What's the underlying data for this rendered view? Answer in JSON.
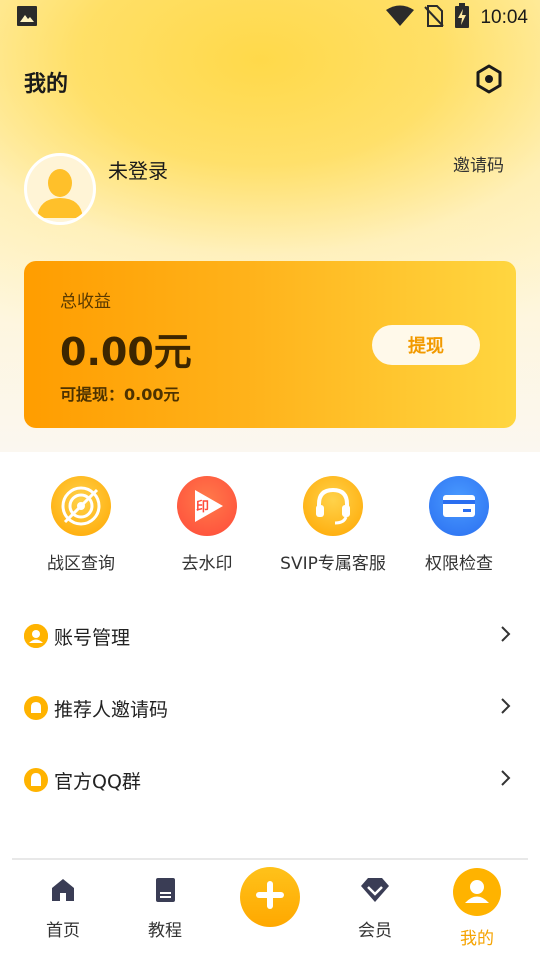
{
  "status_bar": {
    "time": "10:04"
  },
  "header": {
    "title": "我的"
  },
  "profile": {
    "username": "未登录",
    "invite_code_label": "邀请码"
  },
  "earnings": {
    "label": "总收益",
    "amount": "0.00元",
    "withdrawable": "可提现：0.00元",
    "withdraw_button": "提现"
  },
  "tools": [
    {
      "label": "战区查询",
      "icon": "target-icon",
      "color": "#ffb300"
    },
    {
      "label": "去水印",
      "icon": "play-stamp-icon",
      "color": "#ff5a3c"
    },
    {
      "label": "SVIP专属客服",
      "icon": "headset-icon",
      "color": "#ffb300"
    },
    {
      "label": "权限检查",
      "icon": "card-icon",
      "color": "#2f7cf6"
    }
  ],
  "menu": [
    {
      "label": "账号管理",
      "icon": "user-icon"
    },
    {
      "label": "推荐人邀请码",
      "icon": "bell-icon"
    },
    {
      "label": "官方QQ群",
      "icon": "qq-icon"
    }
  ],
  "tabbar": {
    "items": [
      {
        "label": "首页",
        "icon": "home-icon"
      },
      {
        "label": "教程",
        "icon": "book-icon"
      },
      {
        "label": "",
        "icon": "add-icon"
      },
      {
        "label": "会员",
        "icon": "diamond-icon"
      },
      {
        "label": "我的",
        "icon": "profile-icon",
        "active": true
      }
    ]
  },
  "colors": {
    "accent": "#ffb300",
    "active_tab": "#f5a300",
    "card_gradient_start": "#ff9d00",
    "card_gradient_end": "#ffd640"
  }
}
